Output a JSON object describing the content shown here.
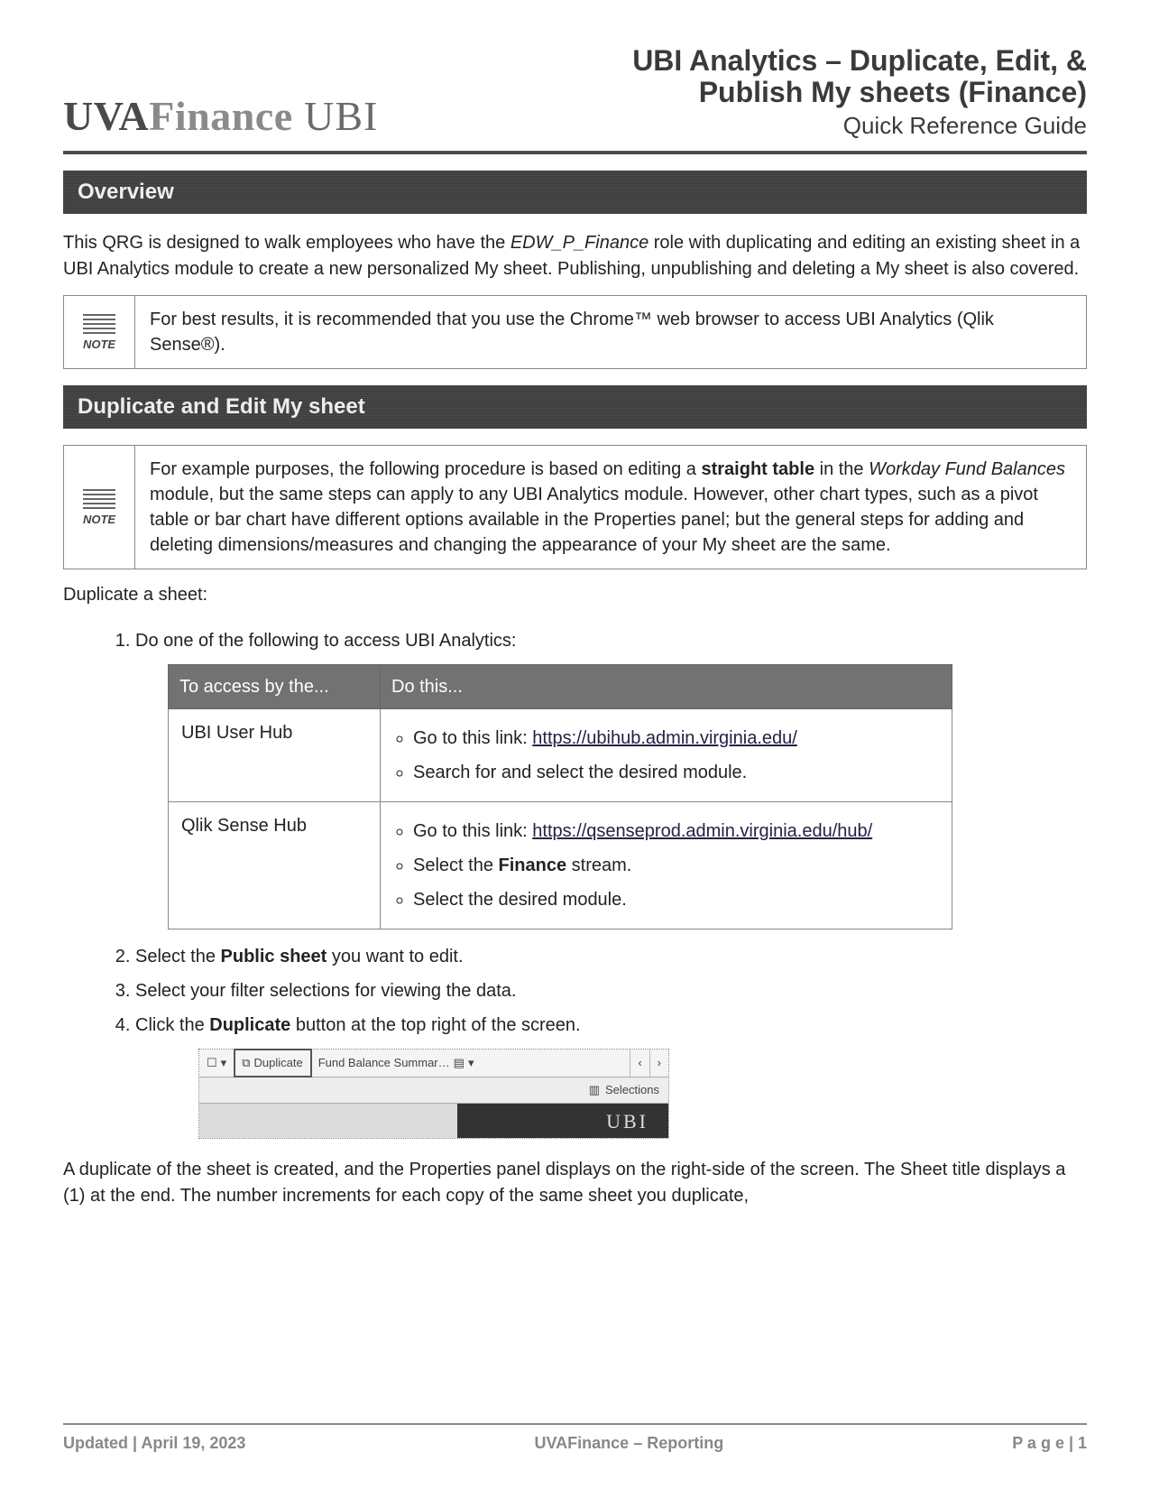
{
  "header": {
    "logo_uva": "UVA",
    "logo_fin": "Finance",
    "logo_ubi": " UBI",
    "title_line1": "UBI Analytics – Duplicate, Edit, &",
    "title_line2": "Publish My sheets (Finance)",
    "subtitle": "Quick Reference Guide"
  },
  "sections": {
    "overview_title": "Overview",
    "overview_text_pre": "This QRG is designed to walk employees who have the ",
    "overview_role": "EDW_P_Finance",
    "overview_text_post": " role with duplicating and editing an existing sheet in a UBI Analytics module to create a new personalized My sheet. Publishing, unpublishing and deleting a My sheet is also covered.",
    "note1": "For best results, it is recommended that you use the Chrome™ web browser to access UBI Analytics (Qlik Sense®).",
    "dup_title": "Duplicate and Edit My sheet",
    "note2_pre": "For example purposes, the following procedure is based on editing a ",
    "note2_bold": "straight table",
    "note2_mid": " in the ",
    "note2_ital": "Workday Fund Balances",
    "note2_post": " module, but the same steps can apply to any UBI Analytics module. However, other chart types, such as a pivot table or bar chart have different options available in the Properties panel; but the general steps for adding and deleting dimensions/measures and changing the appearance of your My sheet are the same.",
    "dup_intro": "Duplicate a sheet:",
    "note_label": "NOTE"
  },
  "steps": {
    "s1": "Do one of the following to access UBI Analytics:",
    "s2_pre": "Select the ",
    "s2_bold": "Public sheet",
    "s2_post": " you want to edit.",
    "s3": "Select your filter selections for viewing the data.",
    "s4_pre": "Click the ",
    "s4_bold": "Duplicate",
    "s4_post": " button at the top right of the screen."
  },
  "table": {
    "h1": "To access by the...",
    "h2": "Do this...",
    "r1c1": "UBI User Hub",
    "r1_b1_pre": "Go to this link: ",
    "r1_b1_link": "https://ubihub.admin.virginia.edu/",
    "r1_b2": "Search for and select the desired module.",
    "r2c1": "Qlik Sense Hub",
    "r2_b1_pre": "Go to this link: ",
    "r2_b1_link": "https://qsenseprod.admin.virginia.edu/hub/",
    "r2_b2_pre": "Select the ",
    "r2_b2_bold": "Finance",
    "r2_b2_post": " stream.",
    "r2_b3": "Select the desired module."
  },
  "screenshot": {
    "bookmark_caret": "▾",
    "dup_label": "Duplicate",
    "sheet_name": "Fund Balance Summar…",
    "caret": "▾",
    "prev": "‹",
    "next": "›",
    "selections": "Selections",
    "ubi": "UBI"
  },
  "closing": "A duplicate of the sheet is created, and the Properties panel displays on the right-side of the screen.  The Sheet title displays a (1) at the end. The number increments for each copy of the same sheet you duplicate,",
  "footer": {
    "left": "Updated | April 19, 2023",
    "center": "UVAFinance – Reporting",
    "right": "P a g e  | 1"
  }
}
